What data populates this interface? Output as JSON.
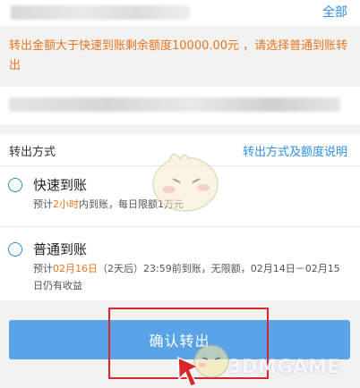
{
  "header": {
    "all_link": "全部"
  },
  "warning_text": "转出金额大于快速到账剩余额度10000.00元 ，请选择普通到账转出",
  "transfer_method": {
    "label": "转出方式",
    "help_link": "转出方式及额度说明",
    "options": [
      {
        "title": "快速到账",
        "desc_prefix": "预计",
        "desc_highlight": "2小时",
        "desc_suffix": "内到账，每日限额1万元",
        "selected": false
      },
      {
        "title": "普通到账",
        "desc_prefix": "预计",
        "desc_highlight": "02月16日",
        "desc_suffix": "（2天后）23:59前到账，无限额，02月14日－02月15日仍有收益",
        "selected": false
      }
    ]
  },
  "confirm_button": "确认转出",
  "watermark": "3DMGAME",
  "colors": {
    "accent_blue": "#2c8ee6",
    "button_blue": "#5aa3e6",
    "warning_orange": "#e8761f",
    "highlight_red": "#d9262c"
  }
}
